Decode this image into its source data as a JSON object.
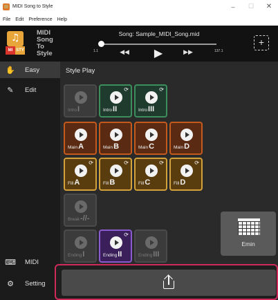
{
  "window": {
    "title": "MIDI Song to Style",
    "controls": {
      "minimize": "–",
      "maximize": "☐",
      "close": "✕"
    }
  },
  "menu": [
    "File",
    "Edit",
    "Preference",
    "Help"
  ],
  "header": {
    "app_title_lines": [
      "MIDI",
      "Song",
      "To",
      "Style"
    ],
    "logo": {
      "mi": "MI",
      "sty": "STY"
    },
    "song_label": "Song: Sample_MIDI_Song.mid",
    "time_start": "1.1",
    "time_end": "137.1",
    "progress": 0.0,
    "add_symbol": "+"
  },
  "sidebar": {
    "items": [
      {
        "label": "Easy",
        "icon": "hand-icon",
        "glyph": "✋",
        "active": true
      },
      {
        "label": "Edit",
        "icon": "edit-icon",
        "glyph": "✎",
        "active": false
      }
    ],
    "bottom_items": [
      {
        "label": "MIDI",
        "icon": "midi-device-icon",
        "glyph": "⌨"
      },
      {
        "label": "Setting",
        "icon": "gear-icon",
        "glyph": "⚙"
      }
    ]
  },
  "main": {
    "section_title": "Style Play",
    "pads": [
      {
        "name": "Intro",
        "roman": "I",
        "color": "gray",
        "loop": false
      },
      {
        "name": "Intro",
        "roman": "II",
        "color": "green",
        "loop": true
      },
      {
        "name": "Intro",
        "roman": "III",
        "color": "green",
        "loop": true
      },
      {
        "name": "Main",
        "roman": "A",
        "color": "orange",
        "loop": false
      },
      {
        "name": "Main",
        "roman": "B",
        "color": "orange",
        "loop": false
      },
      {
        "name": "Main",
        "roman": "C",
        "color": "orange",
        "loop": false
      },
      {
        "name": "Main",
        "roman": "D",
        "color": "orange",
        "loop": false
      },
      {
        "name": "Fill",
        "roman": "A",
        "color": "yellow",
        "loop": true
      },
      {
        "name": "Fill",
        "roman": "B",
        "color": "yellow",
        "loop": true
      },
      {
        "name": "Fill",
        "roman": "C",
        "color": "yellow",
        "loop": true
      },
      {
        "name": "Fill",
        "roman": "D",
        "color": "yellow",
        "loop": true
      },
      {
        "name": "Break",
        "roman": "-//-",
        "color": "gray",
        "loop": false
      },
      {
        "name": "Ending",
        "roman": "I",
        "color": "gray",
        "loop": false
      },
      {
        "name": "Ending",
        "roman": "II",
        "color": "purple",
        "loop": true
      },
      {
        "name": "Ending",
        "roman": "III",
        "color": "gray",
        "loop": false
      }
    ],
    "chord": "Emin"
  },
  "bottom": {
    "share_icon": "share-export-icon"
  },
  "colors": {
    "green": "#3c8e5c",
    "orange": "#c45a1c",
    "yellow": "#d4a23a",
    "purple": "#8a5ad0",
    "highlight": "#d02a5a"
  }
}
